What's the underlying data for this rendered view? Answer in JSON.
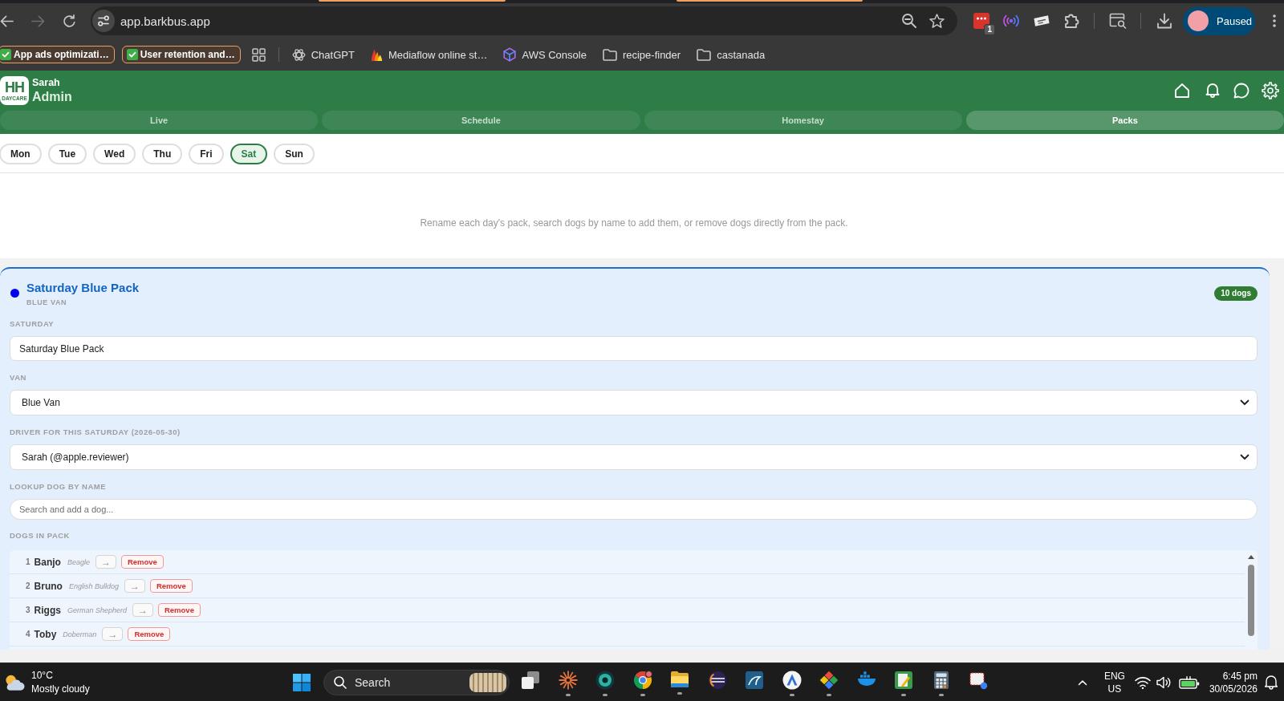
{
  "browser": {
    "nav_buttons": [
      {
        "kind": "back",
        "disabled": false
      },
      {
        "kind": "forward",
        "disabled": true
      },
      {
        "kind": "reload",
        "disabled": false
      }
    ],
    "address": "app.barkbus.app",
    "extensions": [
      {
        "kind": "tile",
        "badge": "1"
      },
      {
        "kind": "waves"
      },
      {
        "kind": "card"
      },
      {
        "kind": "puzzle"
      }
    ],
    "profile": {
      "label": "Paused"
    },
    "bookmarks": [
      {
        "kind": "group",
        "label": "App ads optimizati…"
      },
      {
        "kind": "group",
        "label": "User retention and…"
      },
      {
        "kind": "apps"
      },
      {
        "kind": "atom",
        "label": "ChatGPT"
      },
      {
        "kind": "flame",
        "label": "Mediaflow online st…"
      },
      {
        "kind": "cube",
        "label": "AWS Console"
      },
      {
        "kind": "folder",
        "label": "recipe-finder"
      },
      {
        "kind": "folder",
        "label": "castanada"
      }
    ]
  },
  "app": {
    "logo": {
      "initials": "HH",
      "tagline": "DAYCARE"
    },
    "user": {
      "name": "Sarah",
      "role": "Admin"
    },
    "tabs": [
      {
        "label": "Live",
        "selected": false
      },
      {
        "label": "Schedule",
        "selected": false
      },
      {
        "label": "Homestay",
        "selected": false
      },
      {
        "label": "Packs",
        "selected": true
      }
    ],
    "days": [
      {
        "label": "Mon",
        "selected": false
      },
      {
        "label": "Tue",
        "selected": false
      },
      {
        "label": "Wed",
        "selected": false
      },
      {
        "label": "Thu",
        "selected": false
      },
      {
        "label": "Fri",
        "selected": false
      },
      {
        "label": "Sat",
        "selected": true
      },
      {
        "label": "Sun",
        "selected": false
      }
    ],
    "hint": "Rename each day's pack, search dogs by name to add them, or remove dogs directly from the pack.",
    "pack": {
      "color": "#0000ee",
      "title": "Saturday Blue Pack",
      "subtitle": "BLUE VAN",
      "count": "10 dogs",
      "fields": [
        {
          "kind": "text",
          "label": "SATURDAY",
          "value": "Saturday Blue Pack"
        },
        {
          "kind": "select",
          "label": "VAN",
          "value": "Blue Van"
        },
        {
          "kind": "select",
          "label": "DRIVER FOR THIS SATURDAY (2026-05-30)",
          "value": "Sarah (@apple.reviewer)"
        },
        {
          "kind": "search",
          "label": "LOOKUP DOG BY NAME",
          "placeholder": "Search and add a dog..."
        }
      ],
      "dogs_label": "DOGS IN PACK",
      "dogs": [
        {
          "number": "1",
          "name": "Banjo",
          "breed": "Beagle",
          "move": "→",
          "remove": "Remove"
        },
        {
          "number": "2",
          "name": "Bruno",
          "breed": "English Bulldog",
          "move": "→",
          "remove": "Remove"
        },
        {
          "number": "3",
          "name": "Riggs",
          "breed": "German Shepherd",
          "move": "→",
          "remove": "Remove"
        },
        {
          "number": "4",
          "name": "Toby",
          "breed": "Doberman",
          "move": "→",
          "remove": "Remove"
        }
      ]
    }
  },
  "taskbar": {
    "weather": {
      "temperature": "10°C",
      "condition": "Mostly cloudy"
    },
    "search": {
      "placeholder": "Search"
    },
    "apps": [
      {
        "kind": "squares",
        "running": false
      },
      {
        "kind": "starburst",
        "running": true
      },
      {
        "kind": "orb",
        "running": true
      },
      {
        "kind": "wheel",
        "running": true
      },
      {
        "kind": "folder",
        "running": true
      },
      {
        "kind": "stripes",
        "running": false
      },
      {
        "kind": "wave",
        "running": false
      },
      {
        "kind": "emblem",
        "running": true
      },
      {
        "kind": "diamond",
        "running": true
      },
      {
        "kind": "boat",
        "running": false
      },
      {
        "kind": "notepad",
        "running": true
      },
      {
        "kind": "calculator",
        "running": true
      },
      {
        "kind": "snip",
        "running": false
      }
    ],
    "tray": {
      "language": "ENG",
      "region": "US",
      "time": "6:45 pm",
      "date": "30/05/2026"
    }
  }
}
